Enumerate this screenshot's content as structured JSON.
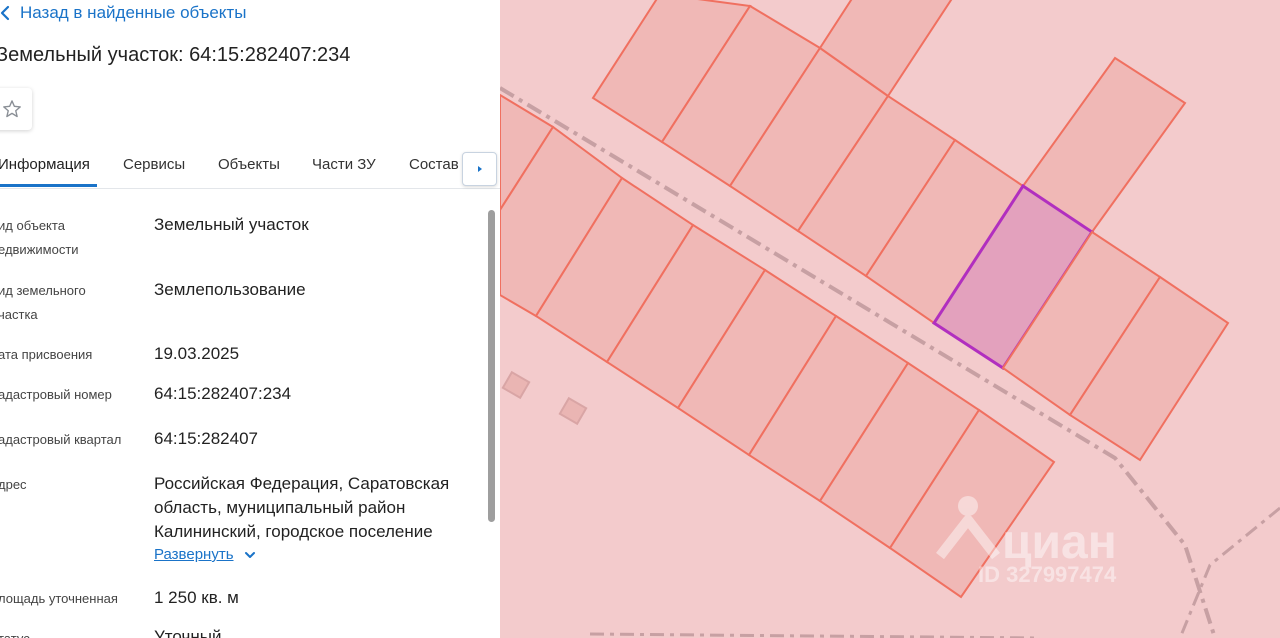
{
  "header": {
    "back_label": "Назад в найденные объекты",
    "title": "Земельный участок: 64:15:282407:234"
  },
  "tabs": [
    {
      "label": "Информация",
      "active": true
    },
    {
      "label": "Сервисы",
      "active": false
    },
    {
      "label": "Объекты",
      "active": false
    },
    {
      "label": "Части ЗУ",
      "active": false
    },
    {
      "label": "Состав",
      "active": false
    }
  ],
  "info": {
    "rows": [
      {
        "label_line1": "ид объекта",
        "label_line2": "едвижимости",
        "value": "Земельный участок"
      },
      {
        "label_line1": "ид земельного",
        "label_line2": "частка",
        "value": "Землепользование"
      },
      {
        "label_line1": "ата присвоения",
        "label_line2": "",
        "value": "19.03.2025"
      },
      {
        "label_line1": "адастровый номер",
        "label_line2": "",
        "value": "64:15:282407:234"
      },
      {
        "label_line1": "адастровый квартал",
        "label_line2": "",
        "value": "64:15:282407"
      },
      {
        "label_line1": "дрес",
        "label_line2": "",
        "value_lines": [
          "Российская Федерация, Саратовская",
          "область, муниципальный район",
          "Калининский, городское поселение"
        ]
      },
      {
        "label_line1": "лощадь уточненная",
        "label_line2": "",
        "value": "1 250 кв. м"
      },
      {
        "label_line1": "татус",
        "label_line2": "",
        "value": "Уточный"
      }
    ],
    "expand_label": "Развернуть"
  },
  "map": {
    "watermark_brand": "циан",
    "watermark_id": "ID 327997474",
    "colors": {
      "background": "#f3cbcc",
      "parcel_fill": "#f0b8b6",
      "parcel_stroke": "#f07060",
      "selected_fill": "#e3a1bd",
      "selected_stroke": "#b12fbf"
    }
  },
  "colors": {
    "accent": "#1a73c8"
  }
}
